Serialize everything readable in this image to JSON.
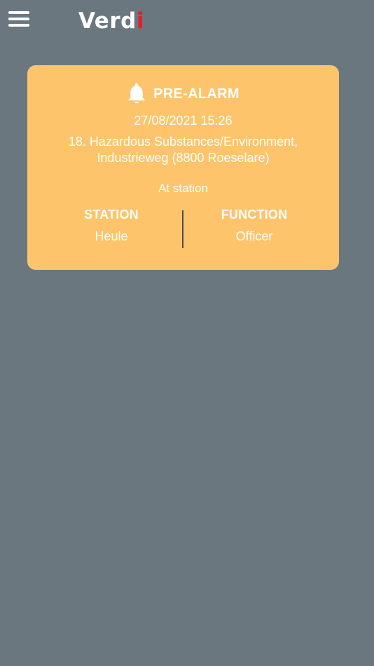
{
  "header": {
    "logo_main": "Verd",
    "logo_accent": "i"
  },
  "alarm_card": {
    "title": "PRE-ALARM",
    "datetime": "27/08/2021 15:26",
    "incident_line1": "18. Hazardous Substances/Environment,",
    "incident_line2": "Industrieweg (8800 Roeselare)",
    "status": "At station",
    "station_label": "STATION",
    "station_value": "Heule",
    "function_label": "FUNCTION",
    "function_value": "Officer"
  },
  "icons": {
    "menu": "hamburger-menu-icon",
    "alarm": "bell-icon"
  },
  "colors": {
    "background": "#6b777f",
    "card": "#fdc46b",
    "logo_accent": "#e21f26",
    "text": "#ffffff"
  }
}
